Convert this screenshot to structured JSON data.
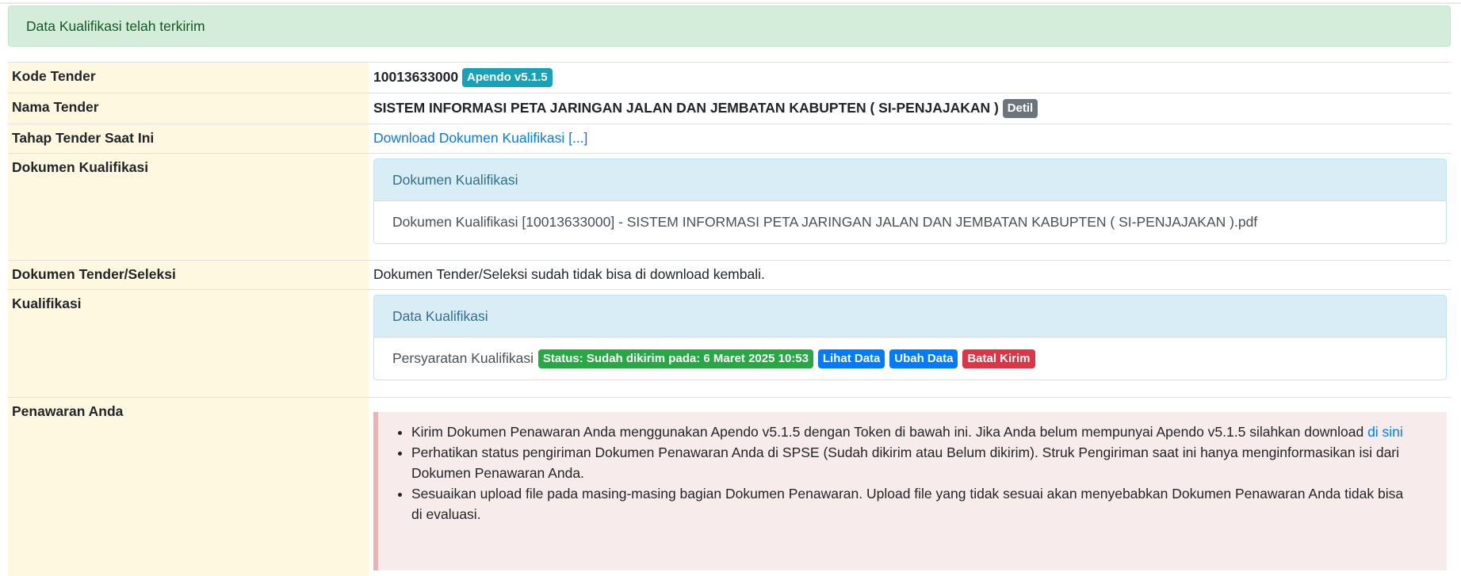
{
  "alert": {
    "message": "Data Kualifikasi telah terkirim"
  },
  "rows": {
    "kode": {
      "label": "Kode Tender",
      "value": "10013633000",
      "badge": "Apendo v5.1.5"
    },
    "nama": {
      "label": "Nama Tender",
      "value": "SISTEM INFORMASI PETA JARINGAN JALAN DAN JEMBATAN KABUPTEN ( SI-PENJAJAKAN )",
      "badge": "Detil"
    },
    "tahap": {
      "label": "Tahap Tender Saat Ini",
      "link": "Download Dokumen Kualifikasi [...]"
    },
    "dok_kualifikasi": {
      "label": "Dokumen Kualifikasi",
      "panel_title": "Dokumen Kualifikasi",
      "file": "Dokumen Kualifikasi [10013633000] - SISTEM INFORMASI PETA JARINGAN JALAN DAN JEMBATAN KABUPTEN ( SI-PENJAJAKAN ).pdf"
    },
    "dok_tender": {
      "label": "Dokumen Tender/Seleksi",
      "value": "Dokumen Tender/Seleksi sudah tidak bisa di download kembali."
    },
    "kualifikasi": {
      "label": "Kualifikasi",
      "panel_title": "Data Kualifikasi",
      "item": "Persyaratan Kualifikasi",
      "status": "Status: Sudah dikirim pada: 6 Maret 2025 10:53",
      "btn_lihat": "Lihat Data",
      "btn_ubah": "Ubah Data",
      "btn_batal": "Batal Kirim"
    },
    "penawaran": {
      "label": "Penawaran Anda",
      "bullet1_text": "Kirim Dokumen Penawaran Anda menggunakan Apendo v5.1.5 dengan Token di bawah ini. Jika Anda belum mempunyai Apendo v5.1.5 silahkan download ",
      "bullet1_link": "di sini",
      "bullet2": "Perhatikan status pengiriman Dokumen Penawaran Anda di SPSE (Sudah dikirim atau Belum dikirim). Struk Pengiriman saat ini hanya menginformasikan isi dari Dokumen Penawaran Anda.",
      "bullet3": "Sesuaikan upload file pada masing-masing bagian Dokumen Penawaran. Upload file yang tidak sesuai akan menyebabkan Dokumen Penawaran Anda tidak bisa di evaluasi."
    }
  }
}
